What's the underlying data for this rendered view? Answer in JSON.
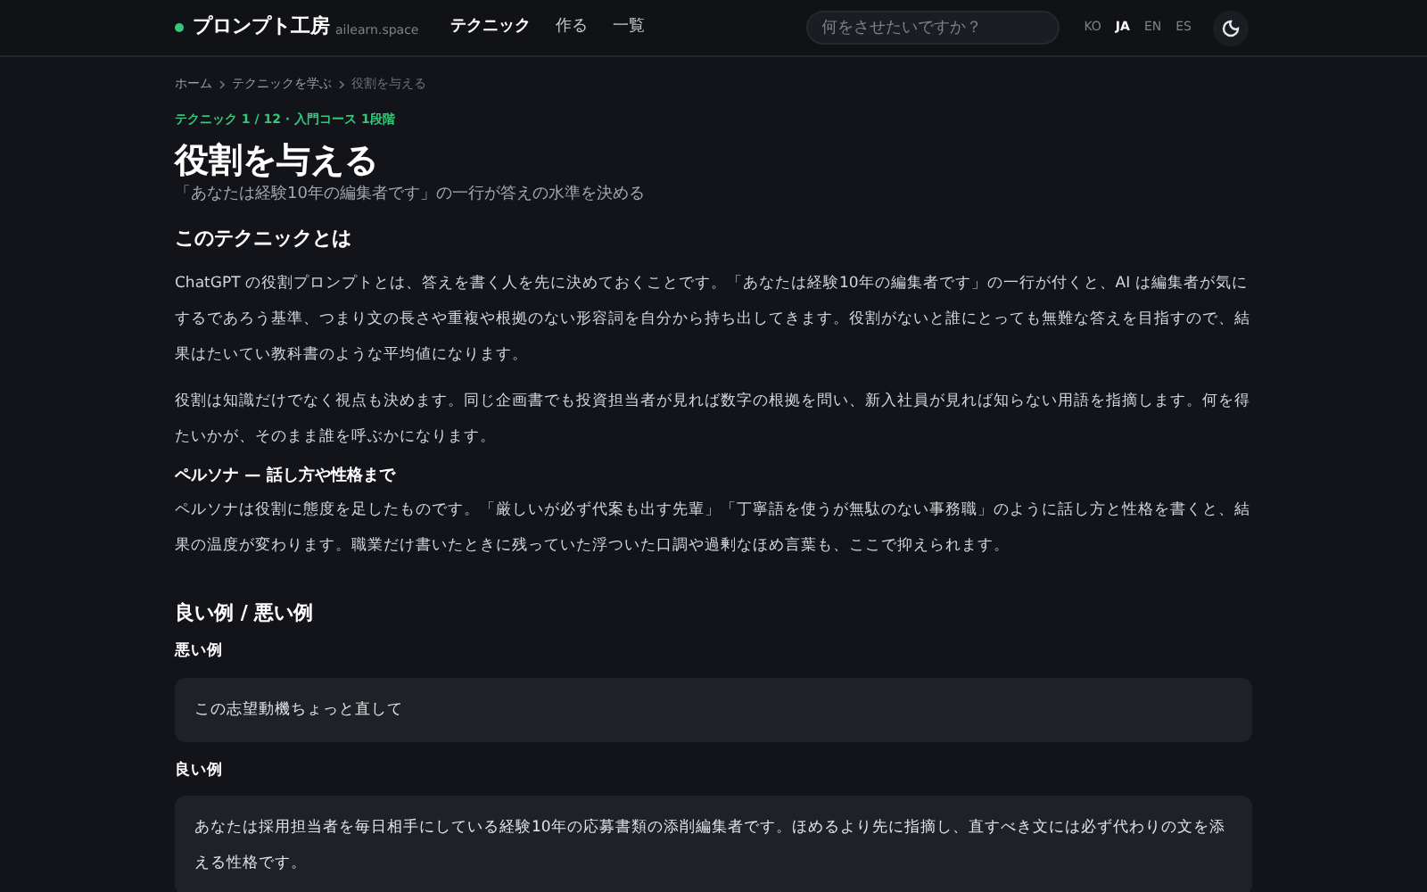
{
  "header": {
    "brand": "プロンプト工房",
    "domain": "ailearn.space",
    "nav": [
      {
        "label": "テクニック",
        "selected": true
      },
      {
        "label": "作る",
        "selected": false
      },
      {
        "label": "一覧",
        "selected": false
      }
    ],
    "search": {
      "placeholder": "何をさせたいですか？"
    },
    "languages": [
      {
        "label": "KO",
        "selected": false
      },
      {
        "label": "JA",
        "selected": true
      },
      {
        "label": "EN",
        "selected": false
      },
      {
        "label": "ES",
        "selected": false
      }
    ]
  },
  "breadcrumb": [
    "ホーム",
    "テクニックを学ぶ",
    "役割を与える"
  ],
  "eyebrow": "テクニック 1 / 12 · 入門コース 1段階",
  "title": "役割を与える",
  "subtitle": "「あなたは経験10年の編集者です」の一行が答えの水準を決める",
  "sections": [
    {
      "kind": "h2",
      "text": "このテクニックとは"
    },
    {
      "kind": "p",
      "text": "ChatGPT の役割プロンプトとは、答えを書く人を先に決めておくことです。「あなたは経験10年の編集者です」の一行が付くと、AI は編集者が気にするであろう基準、つまり文の長さや重複や根拠のない形容詞を自分から持ち出してきます。役割がないと誰にとっても無難な答えを目指すので、結果はたいてい教科書のような平均値になります。"
    },
    {
      "kind": "p",
      "text": "役割は知識だけでなく視点も決めます。同じ企画書でも投資担当者が見れば数字の根拠を問い、新入社員が見れば知らない用語を指摘します。何を得たいかが、そのまま誰を呼ぶかになります。"
    },
    {
      "kind": "h3",
      "text": "ペルソナ — 話し方や性格まで"
    },
    {
      "kind": "p",
      "text": "ペルソナは役割に態度を足したものです。「厳しいが必ず代案も出す先輩」「丁寧語を使うが無駄のない事務職」のように話し方と性格を書くと、結果の温度が変わります。職業だけ書いたときに残っていた浮ついた口調や過剰なほめ言葉も、ここで抑えられます。"
    },
    {
      "kind": "h2",
      "text": "良い例 / 悪い例"
    },
    {
      "kind": "label",
      "text": "悪い例"
    },
    {
      "kind": "example",
      "lines": [
        "この志望動機ちょっと直して"
      ]
    },
    {
      "kind": "label",
      "text": "良い例"
    },
    {
      "kind": "example",
      "lines": [
        "あなたは採用担当者を毎日相手にしている経験10年の応募書類の添削編集者です。ほめるより先に指摘し、直すべき文には必ず代わりの文を添える性格です。"
      ]
    }
  ]
}
